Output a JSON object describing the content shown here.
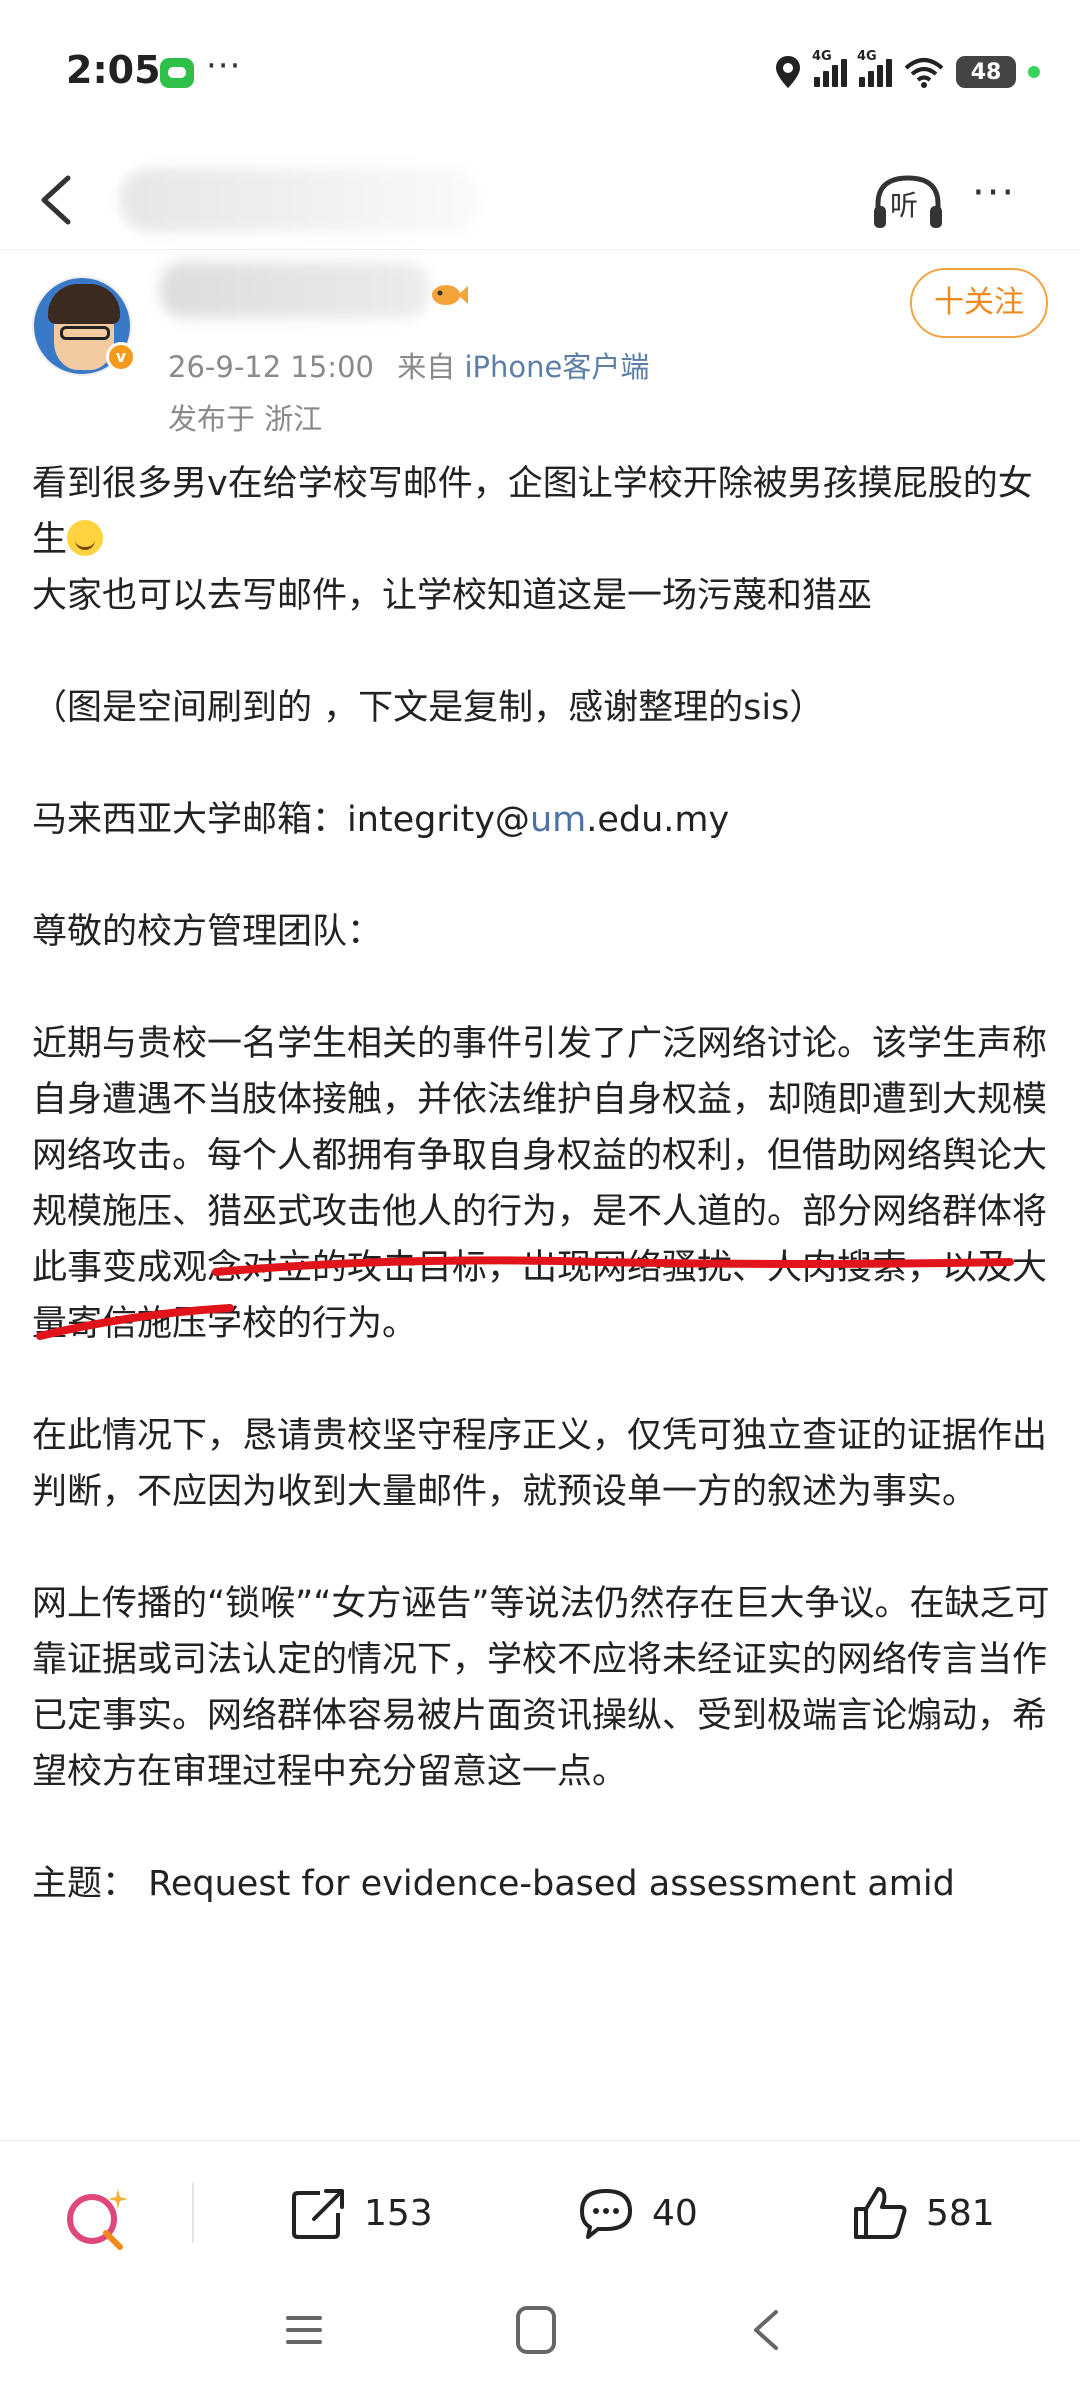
{
  "status_bar": {
    "time": "2:05",
    "more": "···",
    "signal_1": "4G",
    "signal_2": "4G",
    "battery": "48"
  },
  "nav": {
    "listen_label": "听",
    "more": "···"
  },
  "author": {
    "meta_time": "26-9-12 15:00",
    "meta_from": "来自",
    "meta_source": "iPhone客户端",
    "region": "发布于 浙江",
    "follow_label": "十关注"
  },
  "post": {
    "p1": "看到很多男v在给学校写邮件，企图让学校开除被男孩摸屁股的女生",
    "p2": "大家也可以去写邮件，让学校知道这是一场污蔑和猎巫",
    "p3": "（图是空间刷到的 ，下文是复制，感谢整理的sis）",
    "p4_prefix": "马来西亚大学邮箱：integrity@",
    "p4_link": "um",
    "p4_suffix": ".edu.my",
    "p5": "尊敬的校方管理团队：",
    "p6": "近期与贵校一名学生相关的事件引发了广泛网络讨论。该学生声称自身遭遇不当肢体接触，并依法维护自身权益，却随即遭到大规模网络攻击。每个人都拥有争取自身权益的权利，但借助网络舆论大规模施压、猎巫式攻击他人的行为，是不人道的。部分网络群体将此事变成观念对立的攻击目标，出现网络骚扰、人肉搜索，以及大量寄信施压学校的行为。",
    "p7": "在此情况下，恳请贵校坚守程序正义，仅凭可独立查证的证据作出判断，不应因为收到大量邮件，就预设单一方的叙述为事实。",
    "p8": "网上传播的“锁喉”“女方诬告”等说法仍然存在巨大争议。在缺乏可靠证据或司法认定的情况下，学校不应将未经证实的网络传言当作已定事实。网络群体容易被片面资讯操纵、受到极端言论煽动，希望校方在审理过程中充分留意这一点。",
    "p9": "主题： Request for evidence-based assessment amid"
  },
  "actions": {
    "share_count": "153",
    "comment_count": "40",
    "like_count": "581"
  },
  "colors": {
    "accent_orange": "#f08a1c",
    "link_blue": "#4b73a8",
    "underline_red": "#e0141a"
  }
}
